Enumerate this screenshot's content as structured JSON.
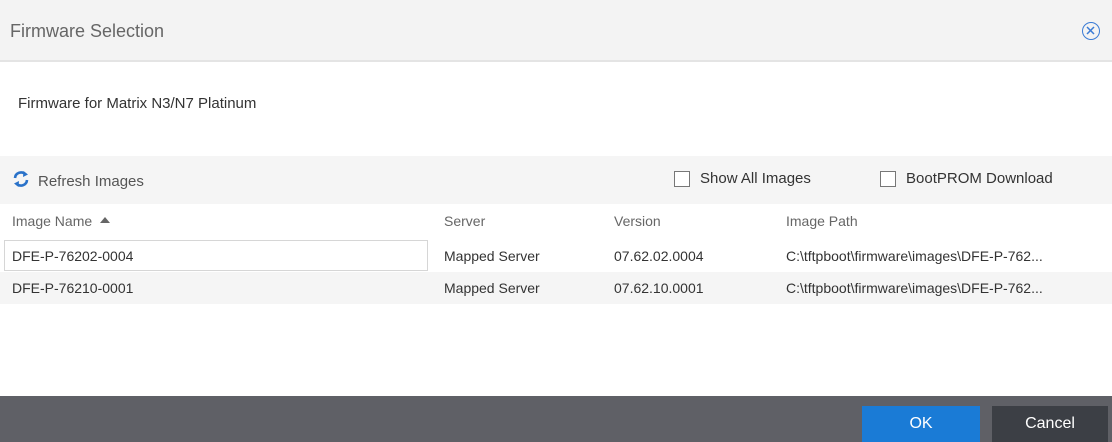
{
  "dialog": {
    "title": "Firmware Selection",
    "subtitle": "Firmware for Matrix N3/N7 Platinum"
  },
  "toolbar": {
    "refresh_label": "Refresh Images",
    "show_all_label": "Show All Images",
    "show_all_checked": false,
    "bootprom_label": "BootPROM Download",
    "bootprom_checked": false
  },
  "table": {
    "columns": [
      "Image Name",
      "Server",
      "Version",
      "Image Path"
    ],
    "sort": {
      "column": "Image Name",
      "direction": "ascending"
    },
    "rows": [
      [
        "DFE-P-76202-0004",
        "Mapped Server",
        "07.62.02.0004",
        "C:\\tftpboot\\firmware\\images\\DFE-P-762..."
      ],
      [
        "DFE-P-76210-0001",
        "Mapped Server",
        "07.62.10.0001",
        "C:\\tftpboot\\firmware\\images\\DFE-P-762..."
      ]
    ]
  },
  "footer": {
    "ok_label": "OK",
    "cancel_label": "Cancel"
  },
  "colors": {
    "accent": "#1a7bd6",
    "footer_bg": "#5f6066",
    "cancel_bg": "#3c3f45"
  },
  "icons": {
    "close": "close-circle-icon",
    "refresh": "refresh-icon",
    "sort": "sort-ascending-icon"
  }
}
